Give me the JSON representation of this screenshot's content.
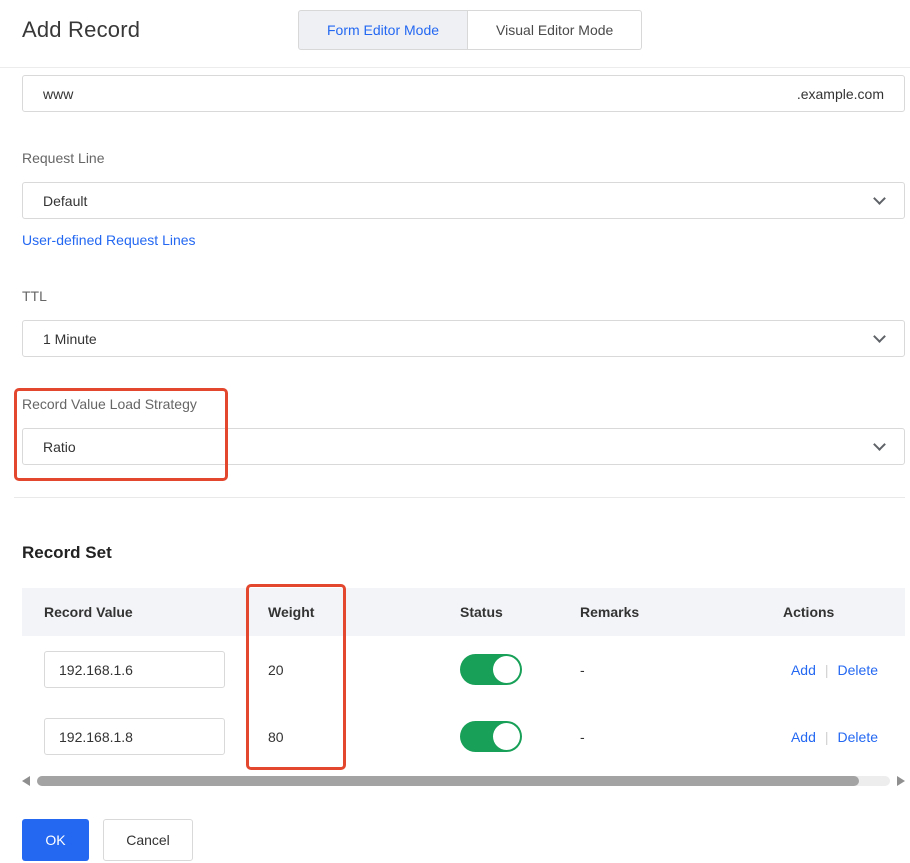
{
  "header": {
    "title": "Add Record",
    "tabs": [
      {
        "label": "Form Editor Mode",
        "active": true
      },
      {
        "label": "Visual Editor Mode",
        "active": false
      }
    ]
  },
  "form": {
    "host": {
      "value": "www",
      "suffix": ".example.com"
    },
    "request_line": {
      "label": "Request Line",
      "value": "Default",
      "link": "User-defined Request Lines"
    },
    "ttl": {
      "label": "TTL",
      "value": "1 Minute"
    },
    "load_strategy": {
      "label": "Record Value Load Strategy",
      "value": "Ratio"
    }
  },
  "record_set": {
    "title": "Record Set",
    "columns": [
      "Record Value",
      "Weight",
      "Status",
      "Remarks",
      "Actions"
    ],
    "action_separator": "|",
    "rows": [
      {
        "record_value": "192.168.1.6",
        "weight": "20",
        "status_on": true,
        "remarks": "-",
        "actions": [
          "Add",
          "Delete"
        ]
      },
      {
        "record_value": "192.168.1.8",
        "weight": "80",
        "status_on": true,
        "remarks": "-",
        "actions": [
          "Add",
          "Delete"
        ]
      }
    ]
  },
  "footer": {
    "ok_label": "OK",
    "cancel_label": "Cancel"
  },
  "colors": {
    "accent_blue": "#2468f2",
    "annotation_red": "#e3472e",
    "toggle_green": "#18a058",
    "table_header_bg": "#f2f4f7"
  }
}
